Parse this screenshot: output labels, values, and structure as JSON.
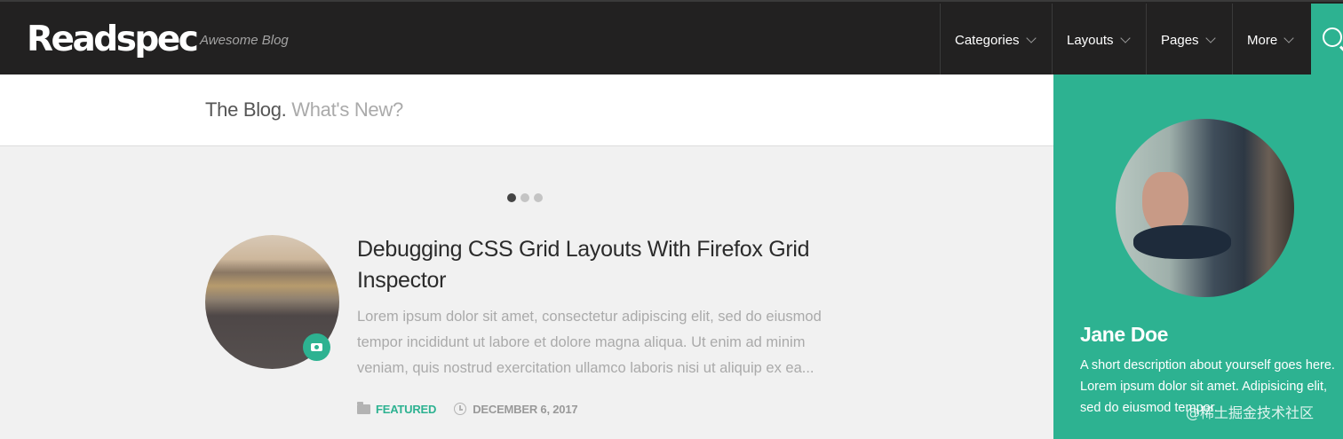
{
  "header": {
    "logo": "Readspec",
    "tagline": "Awesome Blog",
    "nav": [
      {
        "label": "Categories"
      },
      {
        "label": "Layouts"
      },
      {
        "label": "Pages"
      },
      {
        "label": "More"
      }
    ]
  },
  "page": {
    "title": "The Blog.",
    "subtitle": "What's New?"
  },
  "slider": {
    "dot_count": 3,
    "active_index": 0
  },
  "post": {
    "title": "Debugging CSS Grid Layouts With Firefox Grid Inspector",
    "excerpt": "Lorem ipsum dolor sit amet, consectetur adipiscing elit, sed do eiusmod tempor incididunt ut labore et dolore magna aliqua. Ut enim ad minim veniam, quis nostrud exercitation ullamco laboris nisi ut aliquip ex ea...",
    "category": "FEATURED",
    "date": "DECEMBER 6, 2017",
    "format_icon": "camera-icon"
  },
  "sidebar": {
    "author_name": "Jane Doe",
    "author_bio": "A short description about yourself goes here. Lorem ipsum dolor sit amet. Adipisicing elit, sed do eiusmod tempor."
  },
  "watermark": "@稀土掘金技术社区",
  "colors": {
    "accent": "#2db291",
    "topbar": "#222121",
    "page_background": "#f1f1f1"
  }
}
